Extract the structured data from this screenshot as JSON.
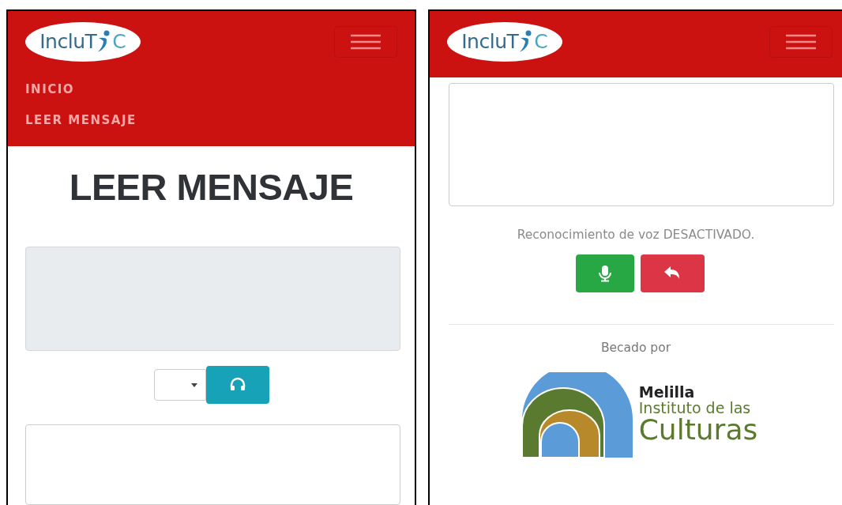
{
  "left_screen": {
    "logo": {
      "text_start": "IncluT",
      "text_end": "C"
    },
    "nav_items": [
      {
        "label": "INICIO"
      },
      {
        "label": "LEER MENSAJE"
      }
    ],
    "heading": "LEER MENSAJE",
    "message_box": {
      "disabled": true
    },
    "listen_button": {
      "kind": "listen"
    },
    "reply_box": {
      "disabled": false
    }
  },
  "right_screen": {
    "logo": {
      "text_start": "IncluT",
      "text_end": "C"
    },
    "reply_box": {
      "disabled": false
    },
    "voice_status": "Reconocimiento de voz DESACTIVADO.",
    "buttons": [
      {
        "kind": "microphone"
      },
      {
        "kind": "back"
      }
    ],
    "sponsor_label": "Becado por",
    "sponsor": {
      "line_1": "Melilla",
      "line_2": "Instituto de las",
      "line_3": "Culturas"
    }
  }
}
